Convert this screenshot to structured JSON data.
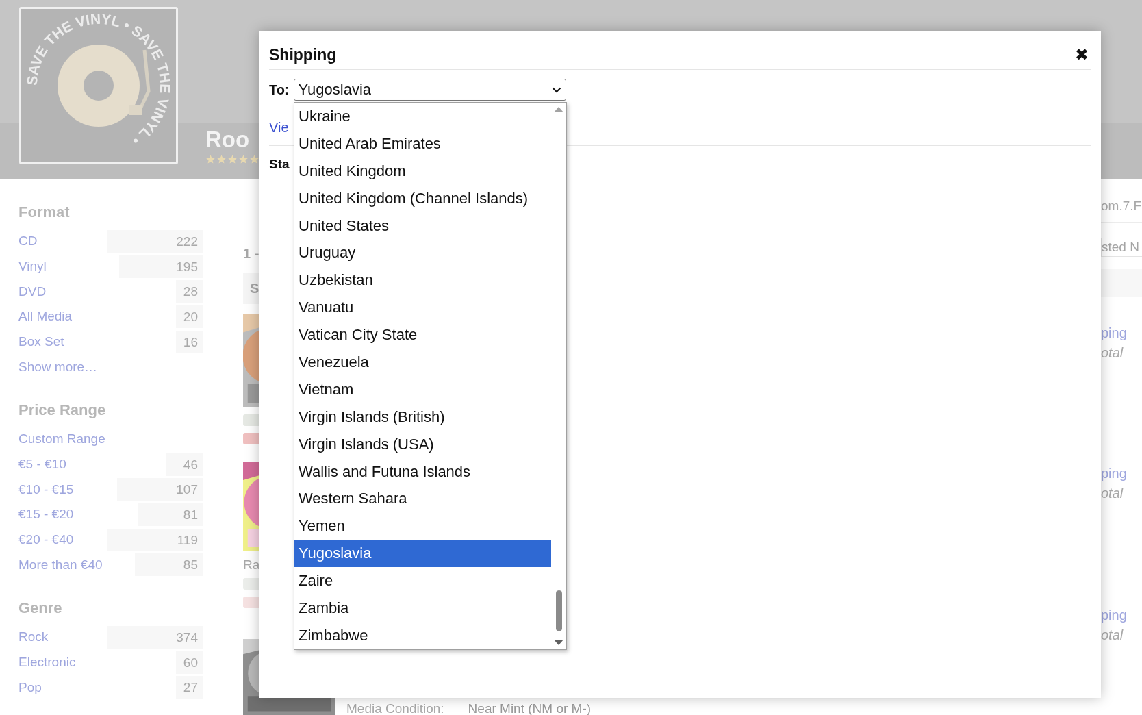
{
  "header": {
    "logo_text": "SAVE THE VINYL • SAVE THE VINYL • ",
    "store_name": "Roo",
    "stars": 5
  },
  "sidebar": {
    "sections": [
      {
        "title": "Format",
        "items": [
          {
            "label": "CD",
            "count": "222"
          },
          {
            "label": "Vinyl",
            "count": "195"
          },
          {
            "label": "DVD",
            "count": "28"
          },
          {
            "label": "All Media",
            "count": "20"
          },
          {
            "label": "Box Set",
            "count": "16"
          }
        ],
        "more": "Show more…"
      },
      {
        "title": "Price Range",
        "items": [
          {
            "label": "Custom Range"
          },
          {
            "label": "€5 - €10",
            "count": "46"
          },
          {
            "label": "€10 - €15",
            "count": "107"
          },
          {
            "label": "€15 - €20",
            "count": "81"
          },
          {
            "label": "€20 - €40",
            "count": "119"
          },
          {
            "label": "More than €40",
            "count": "85"
          }
        ]
      },
      {
        "title": "Genre",
        "items": [
          {
            "label": "Rock",
            "count": "374"
          },
          {
            "label": "Electronic",
            "count": "60"
          },
          {
            "label": "Pop",
            "count": "27"
          }
        ]
      }
    ]
  },
  "listings": {
    "range_text": "1 -",
    "sort_header": "S",
    "caption": "Ra",
    "media_condition_label": "Media Condition:",
    "media_condition_value": "Near Mint (NM or M-)"
  },
  "right_edge": {
    "search_value": "om.7.F",
    "sort_value": "sted N",
    "items": [
      {
        "shipping": "ping",
        "total": "otal"
      },
      {
        "shipping": "ping",
        "total": "otal"
      },
      {
        "shipping": "ping",
        "total": "otal"
      }
    ]
  },
  "dialog": {
    "title": "Shipping",
    "close": "✖",
    "to_label": "To:",
    "value": "Yugoslavia",
    "link": "Vie",
    "section_label": "Sta",
    "options": [
      {
        "label": "Ukraine",
        "selected": false
      },
      {
        "label": "United Arab Emirates",
        "selected": false
      },
      {
        "label": "United Kingdom",
        "selected": false
      },
      {
        "label": "United Kingdom (Channel Islands)",
        "selected": false
      },
      {
        "label": "United States",
        "selected": false
      },
      {
        "label": "Uruguay",
        "selected": false
      },
      {
        "label": "Uzbekistan",
        "selected": false
      },
      {
        "label": "Vanuatu",
        "selected": false
      },
      {
        "label": "Vatican City State",
        "selected": false
      },
      {
        "label": "Venezuela",
        "selected": false
      },
      {
        "label": "Vietnam",
        "selected": false
      },
      {
        "label": "Virgin Islands (British)",
        "selected": false
      },
      {
        "label": "Virgin Islands (USA)",
        "selected": false
      },
      {
        "label": "Wallis and Futuna Islands",
        "selected": false
      },
      {
        "label": "Western Sahara",
        "selected": false
      },
      {
        "label": "Yemen",
        "selected": false
      },
      {
        "label": "Yugoslavia",
        "selected": true
      },
      {
        "label": "Zaire",
        "selected": false
      },
      {
        "label": "Zambia",
        "selected": false
      },
      {
        "label": "Zimbabwe",
        "selected": false
      }
    ]
  }
}
